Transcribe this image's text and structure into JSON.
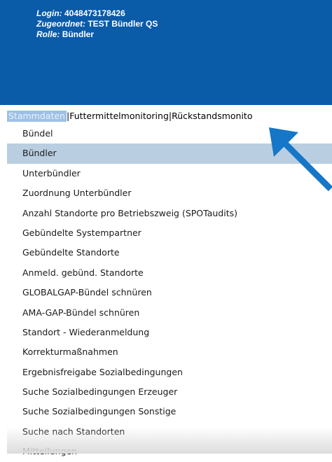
{
  "user": {
    "login_key": "Login:",
    "login_value": "4048473178426",
    "assigned_key": "Zugeordnet:",
    "assigned_value": "TEST Bündler QS",
    "role_key": "Rolle:",
    "role_value": "Bündler"
  },
  "tabs": [
    {
      "label": "Stammdaten"
    },
    {
      "label": "Futtermittelmonitoring"
    },
    {
      "label": "Rückstandsmonito"
    }
  ],
  "tab_separator": "|",
  "menu": {
    "items": [
      {
        "label": "Bündel"
      },
      {
        "label": "Bündler"
      },
      {
        "label": "Unterbündler"
      },
      {
        "label": "Zuordnung Unterbündler"
      },
      {
        "label": "Anzahl Standorte pro Betriebszweig (SPOTaudits)"
      },
      {
        "label": "Gebündelte Systempartner"
      },
      {
        "label": "Gebündelte Standorte"
      },
      {
        "label": "Anmeld. gebünd. Standorte"
      },
      {
        "label": "GLOBALGAP-Bündel schnüren"
      },
      {
        "label": "AMA-GAP-Bündel schnüren"
      },
      {
        "label": "Standort - Wiederanmeldung"
      },
      {
        "label": "Korrekturmaßnahmen"
      },
      {
        "label": "Ergebnisfreigabe Sozialbedingungen"
      },
      {
        "label": "Suche Sozialbedingungen Erzeuger"
      },
      {
        "label": "Suche Sozialbedingungen Sonstige"
      },
      {
        "label": "Suche nach Standorten"
      },
      {
        "label": "Mitteilungen"
      }
    ]
  },
  "colors": {
    "header_bg": "#0a5ba8",
    "selected_bg": "#b9cee1",
    "active_tab_bg": "#9fc0e6",
    "arrow": "#1676c8"
  }
}
